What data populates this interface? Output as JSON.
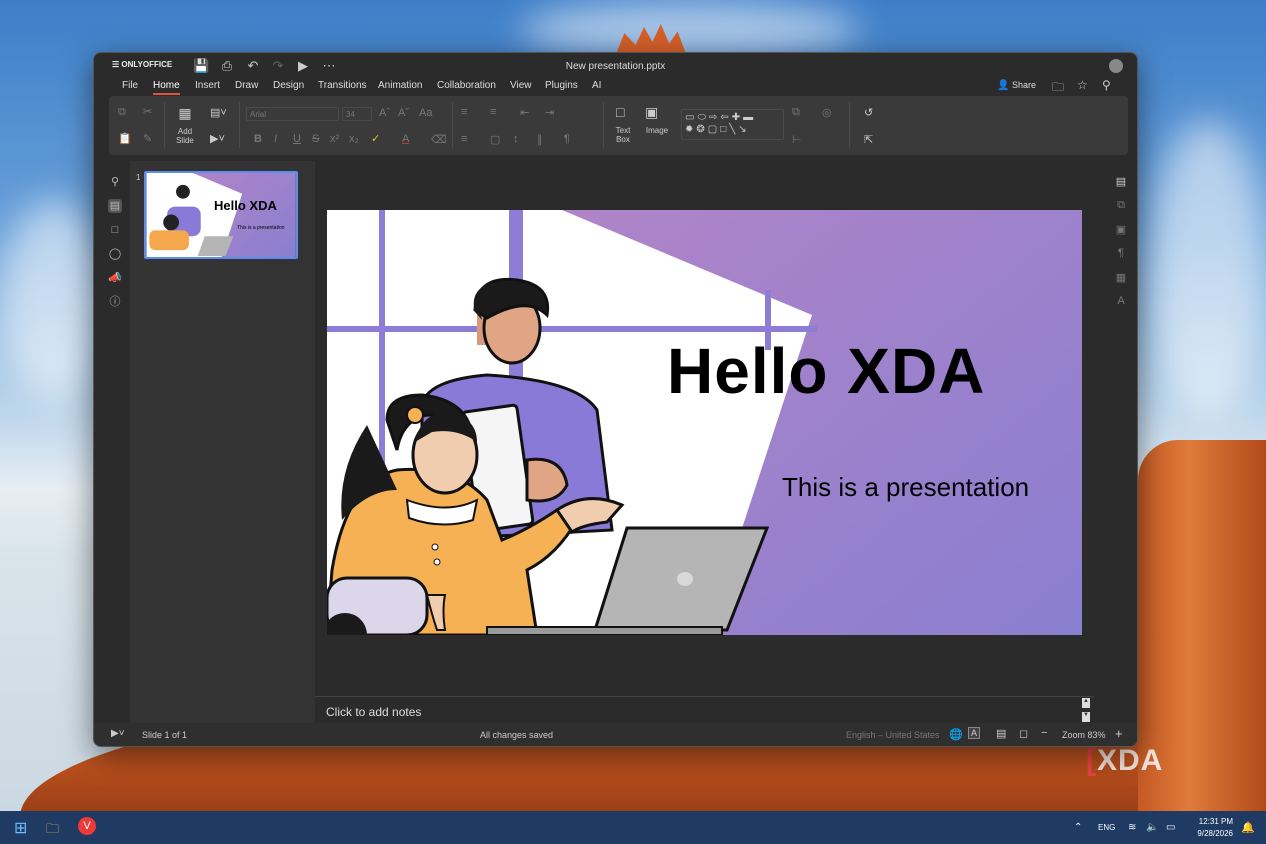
{
  "app": {
    "name": "ONLYOFFICE",
    "document_title": "New presentation.pptx"
  },
  "menu": [
    "File",
    "Home",
    "Insert",
    "Draw",
    "Design",
    "Transitions",
    "Animation",
    "Collaboration",
    "View",
    "Plugins",
    "AI"
  ],
  "menu_active": "Home",
  "share_label": "Share",
  "ribbon": {
    "add_slide": "Add Slide",
    "font_name": "Arial",
    "font_size": "34",
    "text_box": "Text Box",
    "image": "Image"
  },
  "thumbnail": {
    "number": "1",
    "title": "Hello XDA",
    "subtitle": "This is a presentation"
  },
  "slide": {
    "title": "Hello XDA",
    "subtitle": "This is a presentation"
  },
  "notes_placeholder": "Click to add notes",
  "status": {
    "slide_counter": "Slide 1 of 1",
    "save_state": "All changes saved",
    "language": "English – United States",
    "zoom": "Zoom 83%"
  },
  "taskbar": {
    "lang": "ENG",
    "time": "12:31 PM",
    "date": "9/28/2026"
  },
  "watermark": "XDA",
  "colors": {
    "accent": "#e0543a",
    "selection": "#5a8dee",
    "slide_gradient_start": "#b084c8",
    "slide_gradient_end": "#8a7fd0"
  }
}
